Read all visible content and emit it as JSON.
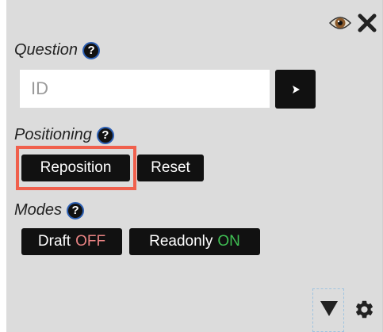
{
  "icons": {
    "eye": "eye-icon",
    "close": "close-icon",
    "help": "help-icon",
    "go": "arrow-right-icon",
    "collapse": "triangle-down-icon",
    "settings": "gear-icon"
  },
  "question": {
    "label": "Question",
    "help": "?",
    "input_value": "",
    "input_placeholder": "ID"
  },
  "positioning": {
    "label": "Positioning",
    "help": "?",
    "reposition_label": "Reposition",
    "reset_label": "Reset"
  },
  "modes": {
    "label": "Modes",
    "help": "?",
    "draft_label": "Draft",
    "draft_state": "OFF",
    "readonly_label": "Readonly",
    "readonly_state": "ON"
  },
  "colors": {
    "panel": "#dcdcdc",
    "button": "#111111",
    "highlight": "#f0604d",
    "off": "#e98383",
    "on": "#3fbf53",
    "help_border": "#2c5fb3"
  }
}
